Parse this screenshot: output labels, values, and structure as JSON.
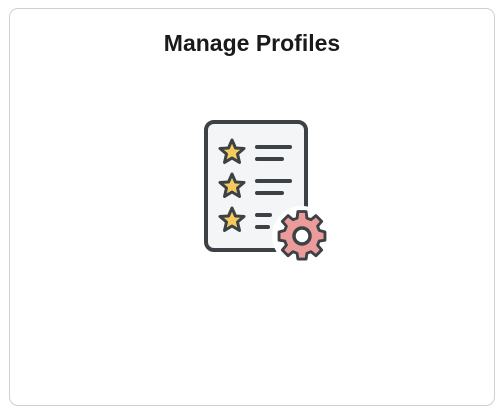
{
  "tile": {
    "title": "Manage Profiles",
    "icon": "profile-list-settings-icon"
  },
  "colors": {
    "border": "#d0d0d0",
    "title": "#1a1a1a",
    "document_fill": "#f3f5f7",
    "document_stroke": "#3c4146",
    "star_fill": "#f5c95c",
    "gear_fill": "#ec9b9b",
    "gear_stroke": "#3c4146"
  }
}
